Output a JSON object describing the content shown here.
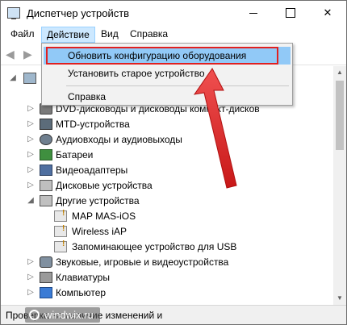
{
  "window": {
    "title": "Диспетчер устройств"
  },
  "menubar": {
    "file": "Файл",
    "action": "Действие",
    "view": "Вид",
    "help": "Справка"
  },
  "dropdown": {
    "items": [
      "Обновить конфигурацию оборудования",
      "Установить старое устройство",
      "Справка"
    ]
  },
  "tree": {
    "rows": [
      {
        "label": "DVD-дисководы и дисководы компакт-дисков",
        "icon": "disc-drive-icon"
      },
      {
        "label": "MTD-устройства",
        "icon": "mtd-device-icon"
      },
      {
        "label": "Аудиовходы и аудиовыходы",
        "icon": "audio-icon"
      },
      {
        "label": "Батареи",
        "icon": "battery-icon"
      },
      {
        "label": "Видеоадаптеры",
        "icon": "display-adapter-icon"
      },
      {
        "label": "Дисковые устройства",
        "icon": "disk-drive-icon"
      },
      {
        "label": "Другие устройства",
        "icon": "other-devices-icon"
      },
      {
        "label": "MAP MAS-iOS",
        "icon": "unknown-device-warning-icon"
      },
      {
        "label": "Wireless iAP",
        "icon": "unknown-device-warning-icon"
      },
      {
        "label": "Запоминающее устройство для USB",
        "icon": "unknown-device-warning-icon"
      },
      {
        "label": "Звуковые, игровые и видеоустройства",
        "icon": "sound-video-icon"
      },
      {
        "label": "Клавиатуры",
        "icon": "keyboard-icon"
      },
      {
        "label": "Компьютер",
        "icon": "computer-icon"
      }
    ]
  },
  "statusbar": {
    "text": "Проверка на наличие изменений и",
    "watermark": "windwix.ru"
  },
  "colors": {
    "menu_highlight": "#cce8ff",
    "dropdown_highlight": "#91c9f7",
    "annotation_red": "#e02020"
  }
}
